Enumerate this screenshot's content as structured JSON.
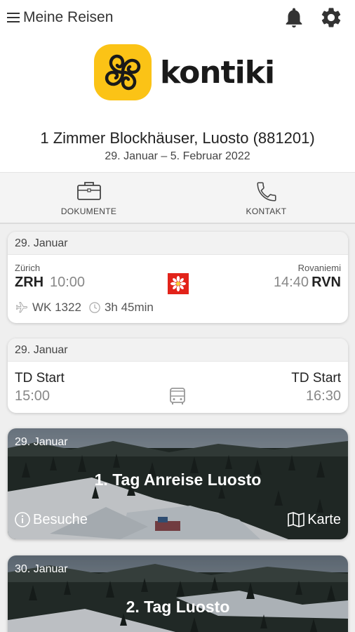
{
  "header": {
    "menu_label": "Meine Reisen",
    "icons": [
      "menu-icon",
      "bell-icon",
      "gear-icon"
    ]
  },
  "brand": {
    "name": "kontiki",
    "accent_color": "#fbc316"
  },
  "trip": {
    "title": "1 Zimmer Blockhäuser, Luosto (881201)",
    "dates": "29. Januar – 5. Februar 2022"
  },
  "tabs": [
    {
      "label": "DOKUMENTE",
      "icon": "briefcase-icon"
    },
    {
      "label": "KONTAKT",
      "icon": "phone-icon"
    }
  ],
  "flight": {
    "date": "29. Januar",
    "from_city": "Zürich",
    "from_code": "ZRH",
    "from_time": "10:00",
    "to_city": "Rovaniemi",
    "to_time": "14:40",
    "to_code": "RVN",
    "flight_no": "WK 1322",
    "duration": "3h 45min",
    "airline_color": "#e2231a"
  },
  "transfer": {
    "date": "29. Januar",
    "from_label": "TD Start",
    "from_time": "15:00",
    "to_label": "TD Start",
    "to_time": "16:30"
  },
  "days": [
    {
      "date": "29. Januar",
      "title": "1. Tag Anreise Luosto",
      "visits_label": "Besuche",
      "map_label": "Karte"
    },
    {
      "date": "30. Januar",
      "title": "2. Tag Luosto"
    }
  ]
}
